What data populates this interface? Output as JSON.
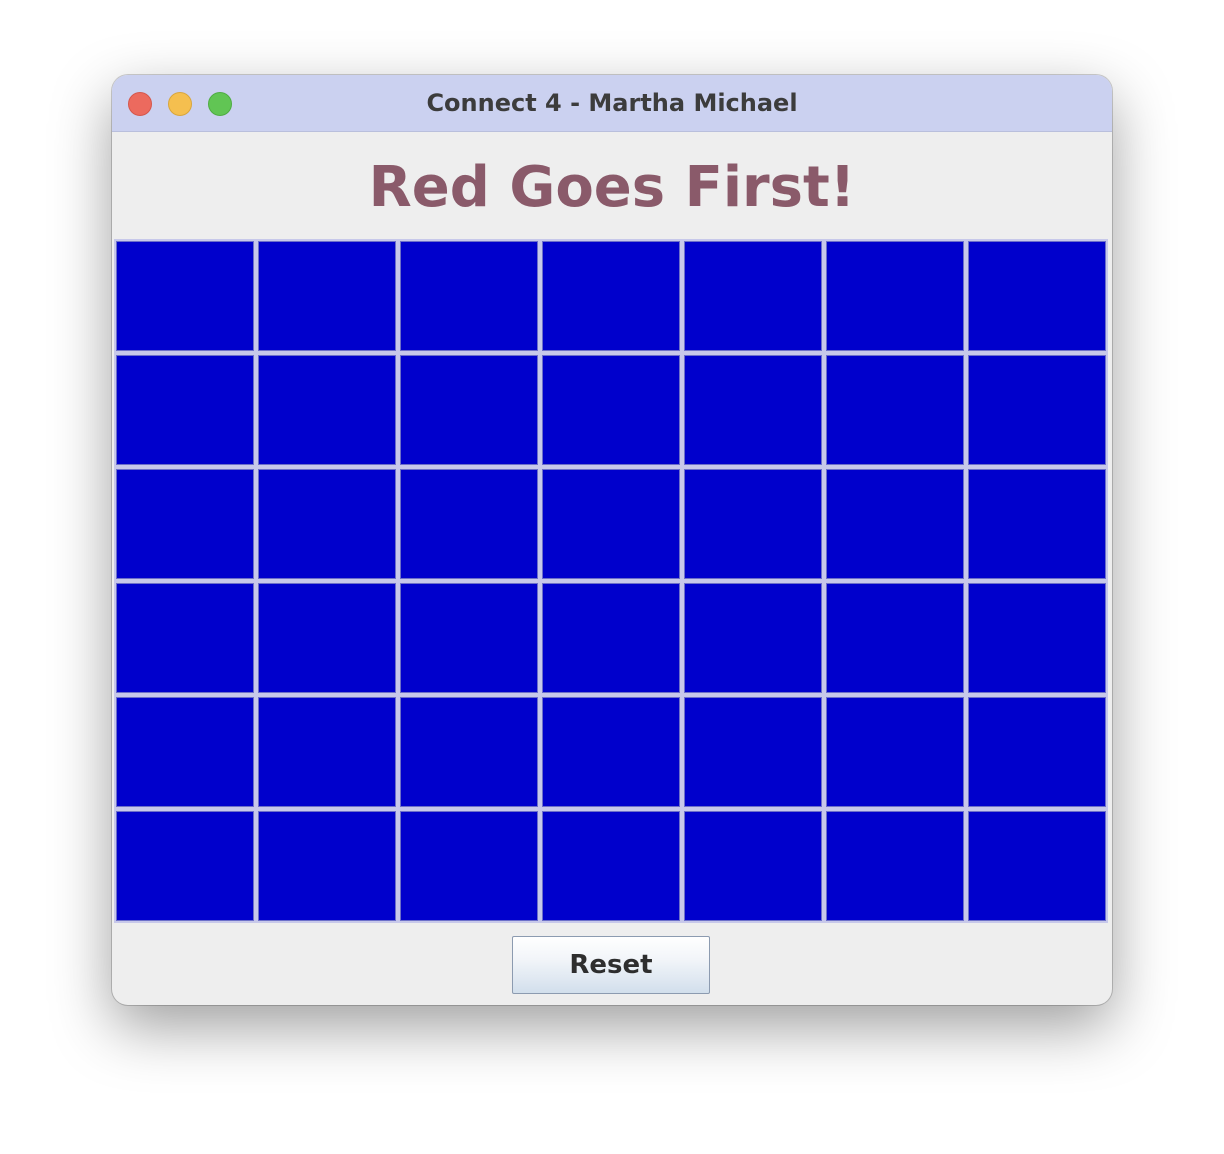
{
  "window": {
    "title": "Connect 4 - Martha Michael"
  },
  "status": {
    "message": "Red Goes First!",
    "color": "#8a5a6a"
  },
  "board": {
    "rows": 6,
    "columns": 7,
    "cell_color": "#0000cc",
    "cells": [
      [
        "",
        "",
        "",
        "",
        "",
        "",
        ""
      ],
      [
        "",
        "",
        "",
        "",
        "",
        "",
        ""
      ],
      [
        "",
        "",
        "",
        "",
        "",
        "",
        ""
      ],
      [
        "",
        "",
        "",
        "",
        "",
        "",
        ""
      ],
      [
        "",
        "",
        "",
        "",
        "",
        "",
        ""
      ],
      [
        "",
        "",
        "",
        "",
        "",
        "",
        ""
      ]
    ]
  },
  "controls": {
    "reset_label": "Reset"
  }
}
